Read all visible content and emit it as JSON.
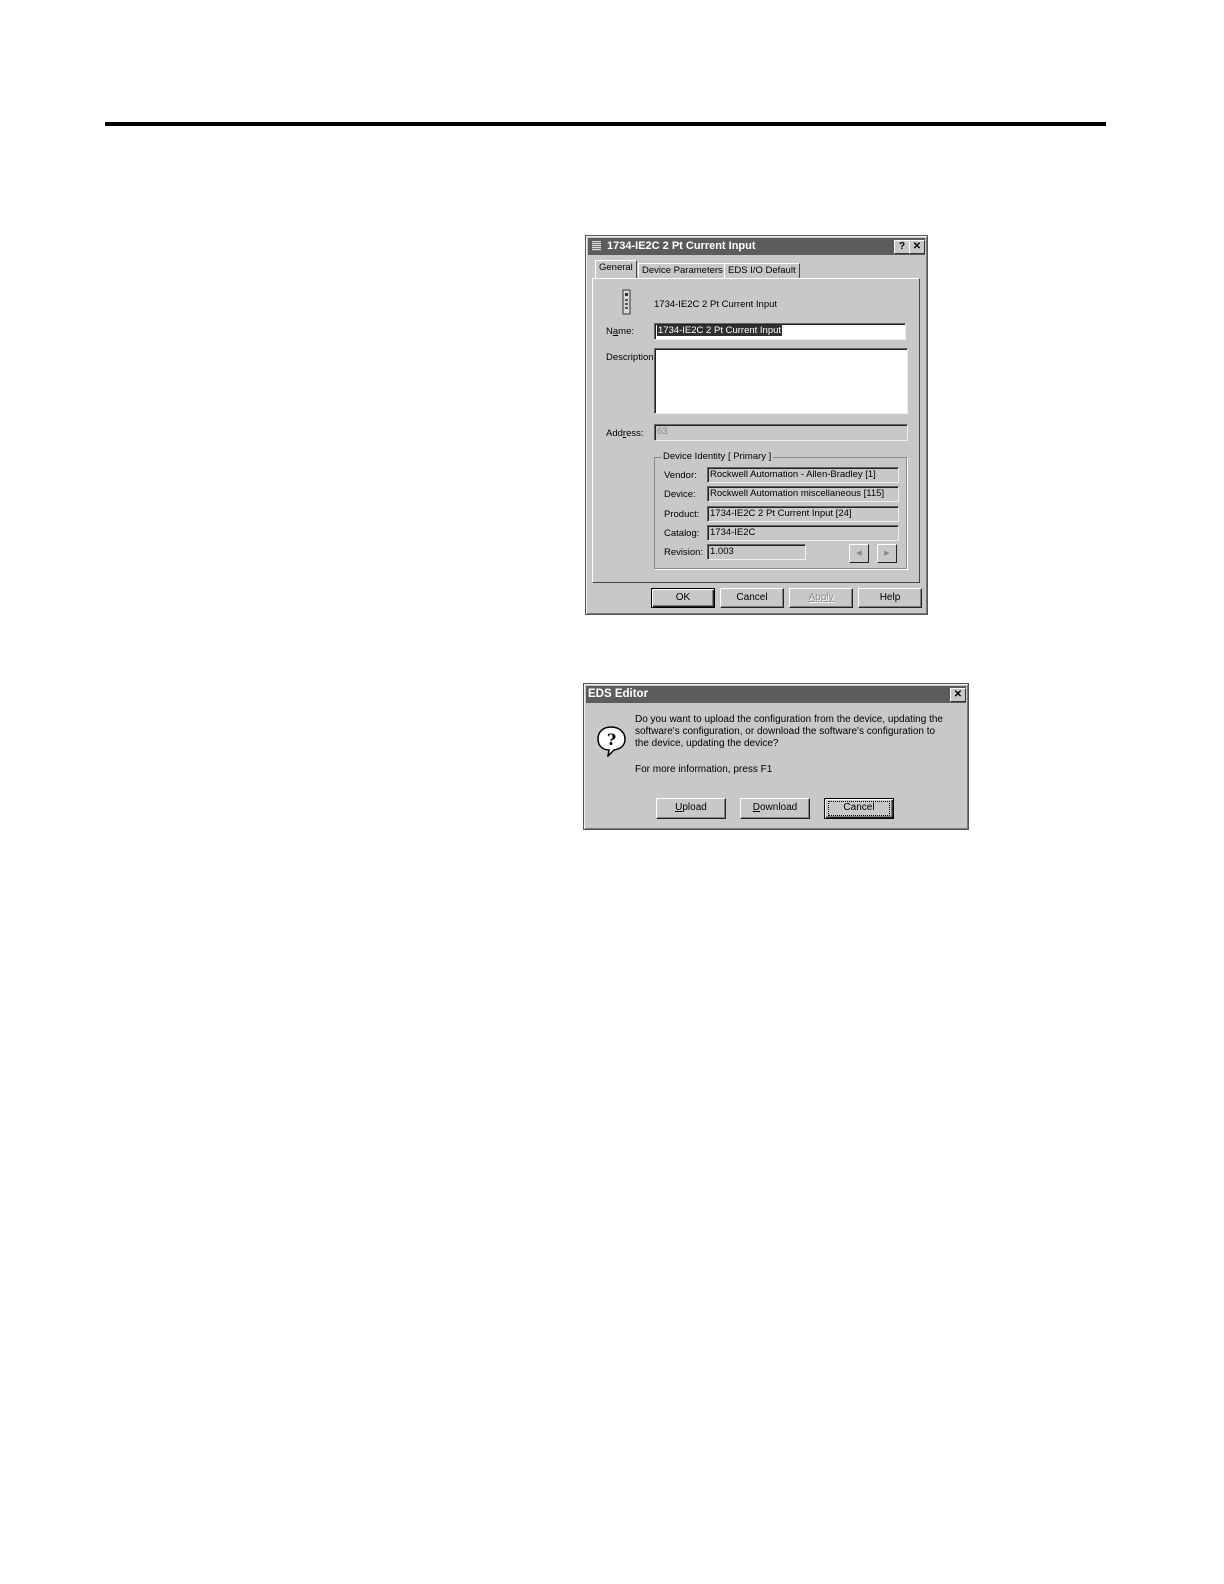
{
  "props_dialog": {
    "title": "1734-IE2C 2 Pt Current Input",
    "help_button": "?",
    "close_button": "✕",
    "tabs": [
      "General",
      "Device Parameters",
      "EDS I/O Default"
    ],
    "device_caption": "1734-IE2C 2 Pt Current Input",
    "name_label_pre": "N",
    "name_label_ul": "a",
    "name_label_post": "me:",
    "name_value": "1734-IE2C 2 Pt Current Input",
    "description_label": "Description:",
    "description_value": "",
    "address_label_pre": "Add",
    "address_label_ul": "r",
    "address_label_post": "ess:",
    "address_value": "63",
    "identity_group_title": "Device Identity [ Primary ]",
    "vendor_label": "Vendor:",
    "vendor_value": "Rockwell Automation - Allen-Bradley [1]",
    "device_label": "Device:",
    "device_value": "Rockwell Automation miscellaneous [115]",
    "product_label": "Product:",
    "product_value": "1734-IE2C 2 Pt Current Input [24]",
    "catalog_label": "Catalog:",
    "catalog_value": "1734-IE2C",
    "revision_label": "Revision:",
    "revision_value": "1.003",
    "prev_arrow": "◀",
    "next_arrow": "▶",
    "ok": "OK",
    "cancel": "Cancel",
    "apply": "Apply",
    "help": "Help"
  },
  "eds_dialog": {
    "title": "EDS Editor",
    "close_button": "✕",
    "question_mark": "?",
    "message_line1": "Do you want to upload the configuration from the device, updating the",
    "message_line2": "software's configuration, or download the software's configuration to",
    "message_line3": "the device, updating the device?",
    "info_text": "For more information, press F1",
    "upload_ul": "U",
    "upload_rest": "pload",
    "download_ul": "D",
    "download_rest": "ownload",
    "cancel": "Cancel"
  }
}
